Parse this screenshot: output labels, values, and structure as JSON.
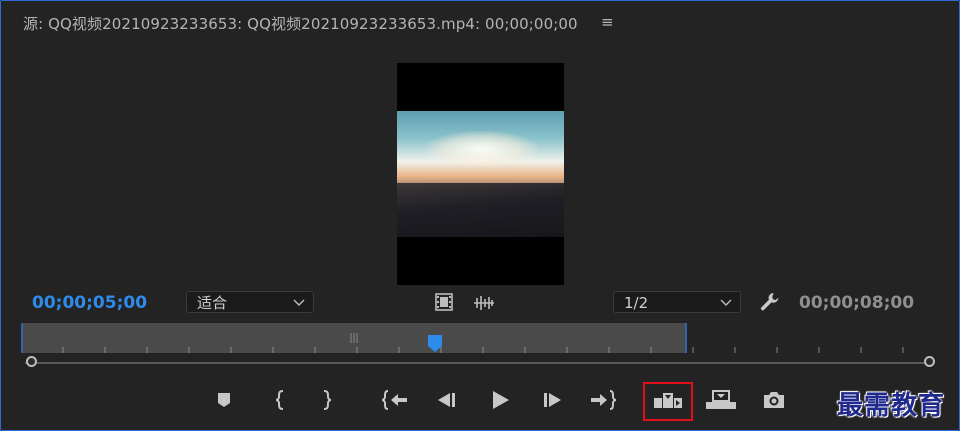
{
  "panel": {
    "title": "源: QQ视频20210923233653: QQ视频20210923233653.mp4: 00;00;00;00",
    "menu_icon": "hamburger-menu-icon"
  },
  "timecode": {
    "current": "00;00;05;00",
    "duration": "00;00;08;00",
    "current_color": "#2d8ceb"
  },
  "zoom_select": {
    "value": "适合"
  },
  "resolution_select": {
    "value": "1/2"
  },
  "toolbar_icons": [
    "drag-video-only-icon",
    "drag-audio-only-icon",
    "settings-wrench-icon"
  ],
  "transport": [
    "add-marker-icon",
    "mark-in-icon",
    "mark-out-icon",
    "go-to-in-icon",
    "step-back-icon",
    "play-icon",
    "step-forward-icon",
    "go-to-out-icon",
    "insert-icon",
    "overwrite-icon",
    "export-frame-icon"
  ],
  "highlight_color": "#e0101a",
  "watermark": "最需教育"
}
